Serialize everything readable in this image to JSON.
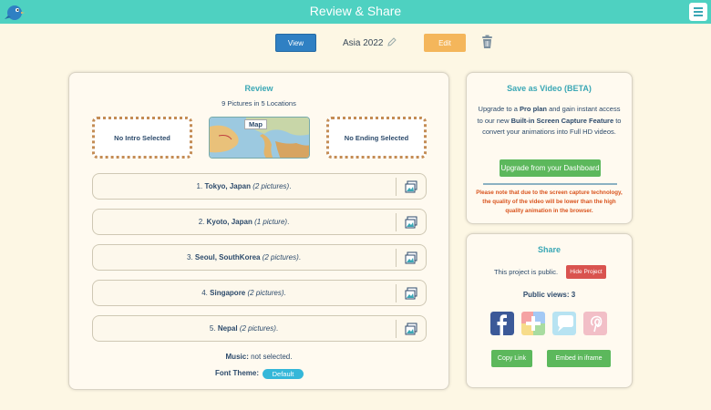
{
  "header": {
    "title": "Review & Share"
  },
  "toolbar": {
    "view_label": "View",
    "project_name": "Asia 2022",
    "edit_label": "Edit"
  },
  "review": {
    "heading": "Review",
    "summary": "9 Pictures in 5 Locations",
    "intro": "No Intro Selected",
    "map_label": "Map",
    "ending": "No Ending Selected",
    "locations": [
      {
        "num": "1.",
        "name": "Tokyo, Japan",
        "count": "(2 pictures)",
        "suffix": "."
      },
      {
        "num": "2.",
        "name": "Kyoto, Japan",
        "count": "(1 picture)",
        "suffix": "."
      },
      {
        "num": "3.",
        "name": "Seoul, SouthKorea",
        "count": "(2 pictures)",
        "suffix": "."
      },
      {
        "num": "4.",
        "name": "Singapore",
        "count": "(2 pictures)",
        "suffix": "."
      },
      {
        "num": "5.",
        "name": "Nepal",
        "count": "(2 pictures)",
        "suffix": "."
      }
    ],
    "music_label": "Music:",
    "music_value": "not selected.",
    "font_theme_label": "Font Theme:",
    "font_theme_value": "Default"
  },
  "video": {
    "heading": "Save as Video (BETA)",
    "text_1": "Upgrade to a ",
    "text_bold_1": "Pro plan",
    "text_2": " and gain instant access to our new ",
    "text_bold_2": "Built-in Screen Capture Feature",
    "text_3": " to convert your animations into Full HD videos.",
    "upgrade_label": "Upgrade from your Dashboard",
    "warning": "Please note that due to the screen capture technology, the quality of the video will be lower than the high quality animation in the browser."
  },
  "share": {
    "heading": "Share",
    "public_text": "This project is public.",
    "hide_label": "Hide Project",
    "views_label": "Public views: 3",
    "copy_label": "Copy Link",
    "embed_label": "Embed in iframe"
  },
  "colors": {
    "accent": "#4ed1c1",
    "heading": "#3aa7b5",
    "primary": "#2f80c3",
    "edit": "#f4b65b",
    "success": "#5cb85c",
    "danger": "#d9534f",
    "facebook": "#3b5998",
    "google_plus": "#d9d2a6",
    "pinterest": "#f2bfc7"
  },
  "icons": {
    "logo": "bird-logo-icon",
    "menu": "hamburger-menu-icon",
    "pencil": "pencil-icon",
    "trash": "trash-icon",
    "picture": "picture-icon",
    "facebook": "facebook-icon",
    "google_plus": "google-plus-icon",
    "chat": "chat-bubble-icon",
    "pinterest": "pinterest-icon"
  }
}
